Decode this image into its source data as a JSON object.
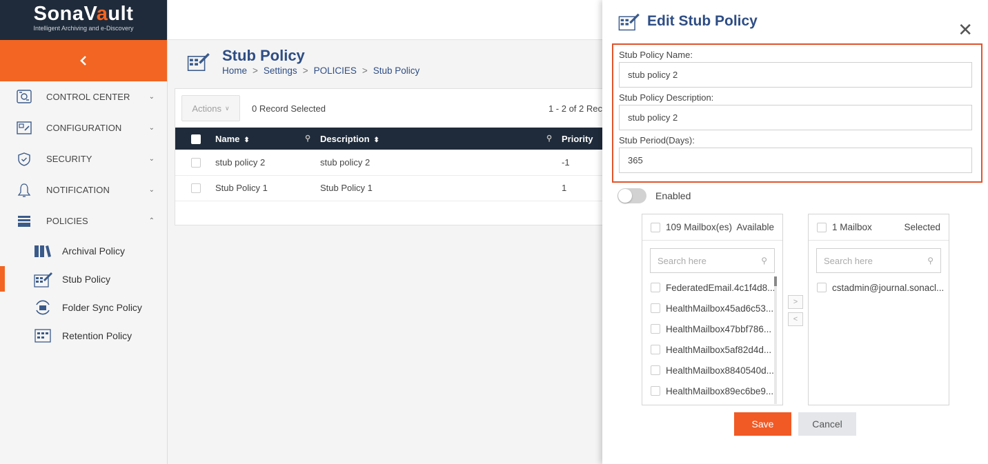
{
  "brand": {
    "name_pre": "SonaV",
    "name_accent": "a",
    "name_post": "ult",
    "tagline": "Intelligent Archiving and e-Discovery"
  },
  "sidebar": {
    "collapse_icon": "chevron-left-icon",
    "items": [
      {
        "label": "CONTROL CENTER",
        "icon": "control-center-icon",
        "chev": "⌄"
      },
      {
        "label": "CONFIGURATION",
        "icon": "configuration-icon",
        "chev": "⌄"
      },
      {
        "label": "SECURITY",
        "icon": "shield-icon",
        "chev": "⌄"
      },
      {
        "label": "NOTIFICATION",
        "icon": "bell-icon",
        "chev": "⌄"
      },
      {
        "label": "POLICIES",
        "icon": "policies-icon",
        "chev": "⌃"
      }
    ],
    "sub_items": [
      {
        "label": "Archival Policy",
        "icon": "archival-policy-icon"
      },
      {
        "label": "Stub Policy",
        "icon": "stub-policy-icon"
      },
      {
        "label": "Folder Sync Policy",
        "icon": "folder-sync-icon"
      },
      {
        "label": "Retention Policy",
        "icon": "retention-policy-icon"
      }
    ]
  },
  "page": {
    "title": "Stub Policy",
    "breadcrumb": [
      "Home",
      "Settings",
      "POLICIES",
      "Stub Policy"
    ],
    "breadcrumb_sep": ">"
  },
  "grid": {
    "actions_label": "Actions",
    "selected_text": "0 Record Selected",
    "range_text": "1 - 2 of 2 Rec",
    "columns": [
      "Name",
      "Description",
      "Priority"
    ],
    "rows": [
      {
        "name": "stub policy 2",
        "description": "stub policy 2",
        "priority": "-1"
      },
      {
        "name": "Stub Policy 1",
        "description": "Stub Policy 1",
        "priority": "1"
      }
    ]
  },
  "drawer": {
    "title": "Edit Stub Policy",
    "close": "✕",
    "fields": [
      {
        "label": "Stub Policy Name:",
        "value": "stub policy 2"
      },
      {
        "label": "Stub Policy Description:",
        "value": "stub policy 2"
      },
      {
        "label": "Stub Period(Days):",
        "value": "365"
      }
    ],
    "enabled_label": "Enabled",
    "available": {
      "count_text": "109 Mailbox(es)",
      "status": "Available",
      "search_placeholder": "Search here",
      "items": [
        "FederatedEmail.4c1f4d8...",
        "HealthMailbox45ad6c53...",
        "HealthMailbox47bbf786...",
        "HealthMailbox5af82d4d...",
        "HealthMailbox8840540d...",
        "HealthMailbox89ec6be9..."
      ]
    },
    "selected": {
      "count_text": "1 Mailbox",
      "status": "Selected",
      "search_placeholder": "Search here",
      "items": [
        "cstadmin@journal.sonacl..."
      ]
    },
    "move_right": ">",
    "move_left": "<",
    "save_label": "Save",
    "cancel_label": "Cancel"
  },
  "colors": {
    "accent": "#f26522",
    "navy": "#1f2b3a",
    "title_blue": "#2e4d84",
    "highlight_border": "#e0532a"
  }
}
